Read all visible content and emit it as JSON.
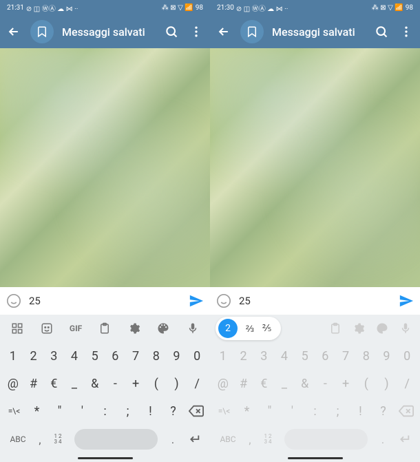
{
  "left": {
    "status": {
      "time": "21:31",
      "battery": "98"
    },
    "header": {
      "title": "Messaggi salvati"
    },
    "input": {
      "value": "25"
    },
    "kb": {
      "toolbar": [
        "⊞",
        "☺",
        "GIF",
        "📋",
        "⚙",
        "🎨",
        "🎤"
      ],
      "row1": [
        "1",
        "2",
        "3",
        "4",
        "5",
        "6",
        "7",
        "8",
        "9",
        "0"
      ],
      "row2": [
        "@",
        "#",
        "€",
        "_",
        "&",
        "-",
        "+",
        "(",
        ")",
        "/"
      ],
      "row3": [
        "=\\<",
        "*",
        "\"",
        "'",
        ":",
        ";",
        "!",
        "?",
        "⌫"
      ],
      "abc": "ABC",
      "nums_top": "1 2",
      "nums_bot": "3 4",
      "dot": ".",
      "comma": ","
    }
  },
  "right": {
    "status": {
      "time": "21:30",
      "battery": "98"
    },
    "header": {
      "title": "Messaggi salvati"
    },
    "input": {
      "value": "25"
    },
    "suggestions": {
      "highlighted": "2",
      "alt1": "⅔",
      "alt2": "⅖"
    },
    "kb": {
      "row1": [
        "1",
        "2",
        "3",
        "4",
        "5",
        "6",
        "7",
        "8",
        "9",
        "0"
      ],
      "row2": [
        "@",
        "#",
        "€",
        "_",
        "&",
        "-",
        "+",
        "(",
        ")",
        "/"
      ],
      "row3": [
        "=\\<",
        "*",
        "\"",
        "'",
        ":",
        ";",
        "!",
        "?",
        "⌫"
      ],
      "abc": "ABC",
      "nums_top": "1 2",
      "nums_bot": "3 4",
      "dot": ".",
      "comma": ","
    }
  }
}
